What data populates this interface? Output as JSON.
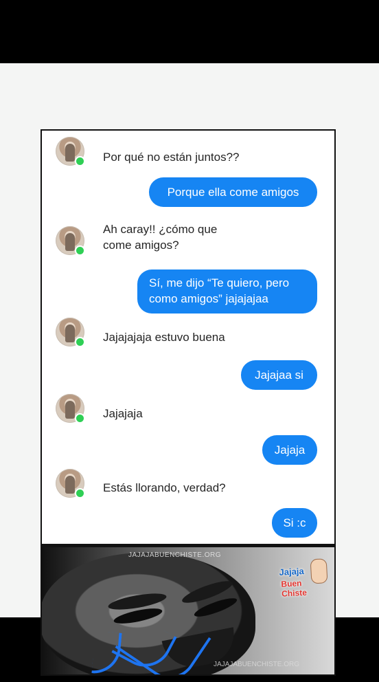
{
  "messages": [
    {
      "side": "in",
      "text": "Por qué no están juntos??"
    },
    {
      "side": "out",
      "text": "Porque ella come amigos"
    },
    {
      "side": "in",
      "text": "Ah caray!! ¿cómo que come amigos?"
    },
    {
      "side": "out",
      "text": "Sí, me dijo “Te quiero, pero como amigos” jajajajaa"
    },
    {
      "side": "in",
      "text": "Jajajajaja estuvo buena"
    },
    {
      "side": "out",
      "text": "Jajajaa si"
    },
    {
      "side": "in",
      "text": "Jajajaja"
    },
    {
      "side": "out",
      "text": "Jajaja"
    },
    {
      "side": "in",
      "text": "Estás llorando, verdad?"
    },
    {
      "side": "out",
      "text": "Si :c"
    }
  ],
  "meme": {
    "watermark_top": "JAJAJABUENCHISTE.ORG",
    "watermark_bottom": "JAJAJABUENCHISTE.ORG",
    "logo_line1": "Jajaja",
    "logo_line2": "Buen Chiste"
  },
  "colors": {
    "background": "#000000",
    "bubble_blue": "#1685f3",
    "online_green": "#2fcf55"
  },
  "icons": [
    "user-avatar-icon",
    "online-status-icon",
    "meme-logo-icon"
  ]
}
